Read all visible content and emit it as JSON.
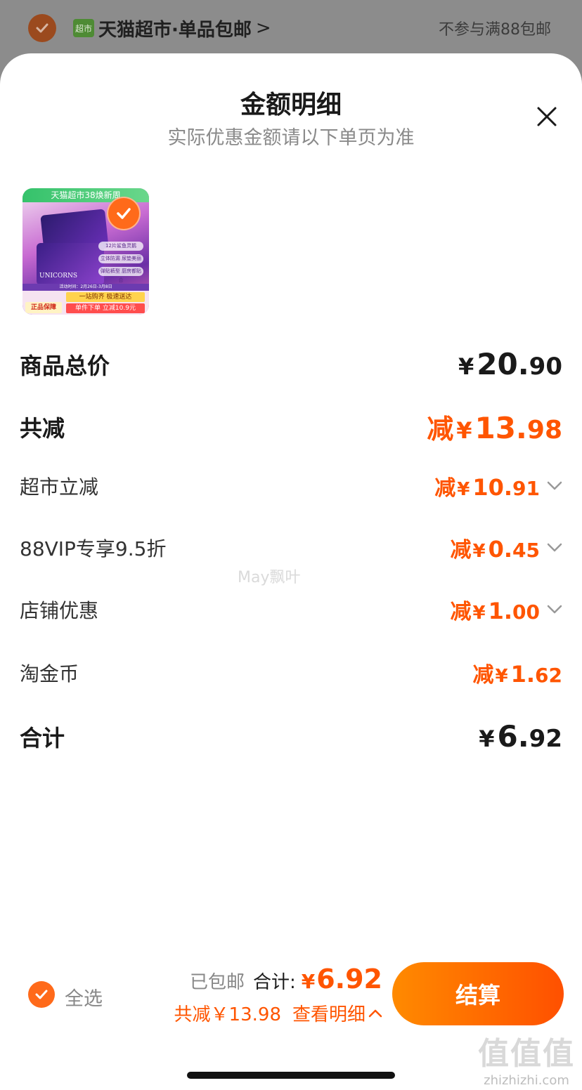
{
  "background_header": {
    "store_logo_text": "超市",
    "store_name": "天猫超市·单品包邮",
    "chevron": ">",
    "note": "不参与满88包邮"
  },
  "sheet": {
    "title": "金额明细",
    "subtitle": "实际优惠金额请以下单页为准",
    "close_icon": "close-icon"
  },
  "product": {
    "banner": "天猫超市38焕新周",
    "brand": "UNICORNS",
    "tags": [
      "12片鲨鱼灵鹅",
      "立体防漏 尿垫美丽",
      "弹贴裤型 厨房都贴合"
    ],
    "strip": "活动时间：2月26日-3月8日",
    "badge1": "一站购齐 极速送达",
    "badge2": "单件下单 立减10.9元",
    "badge3": "正品保障",
    "selected": true
  },
  "rows": [
    {
      "label": "商品总价",
      "prefix": "",
      "currency": "¥",
      "int": "20.",
      "dec": "90",
      "style": "total"
    },
    {
      "label": "共减",
      "prefix": "减",
      "currency": "¥",
      "int": "13.",
      "dec": "98",
      "style": "discount-total"
    },
    {
      "label": "超市立减",
      "prefix": "减",
      "currency": "¥",
      "int": "10.",
      "dec": "91",
      "expandable": true
    },
    {
      "label": "88VIP专享9.5折",
      "prefix": "减",
      "currency": "¥",
      "int": "0.",
      "dec": "45",
      "expandable": true
    },
    {
      "label": "店铺优惠",
      "prefix": "减",
      "currency": "¥",
      "int": "1.",
      "dec": "00",
      "expandable": true
    },
    {
      "label": "淘金币",
      "prefix": "减",
      "currency": "¥",
      "int": "1.",
      "dec": "62",
      "expandable": false
    },
    {
      "label": "合计",
      "prefix": "",
      "currency": "¥",
      "int": "6.",
      "dec": "92",
      "style": "total"
    }
  ],
  "watermark": "May飘叶",
  "bottom_bar": {
    "select_all_label": "全选",
    "shipping": "已包邮",
    "total_label": "合计:",
    "total_currency": "¥",
    "total_value": "6.92",
    "discount_text": "共减￥13.98",
    "detail_link": "查看明细",
    "checkout_label": "结算"
  },
  "corner_watermark": {
    "big": "值值值",
    "small": "zhizhizhi.com"
  },
  "colors": {
    "accent": "#ff5500",
    "button_gradient_start": "#ff8a00",
    "button_gradient_end": "#ff5000"
  }
}
